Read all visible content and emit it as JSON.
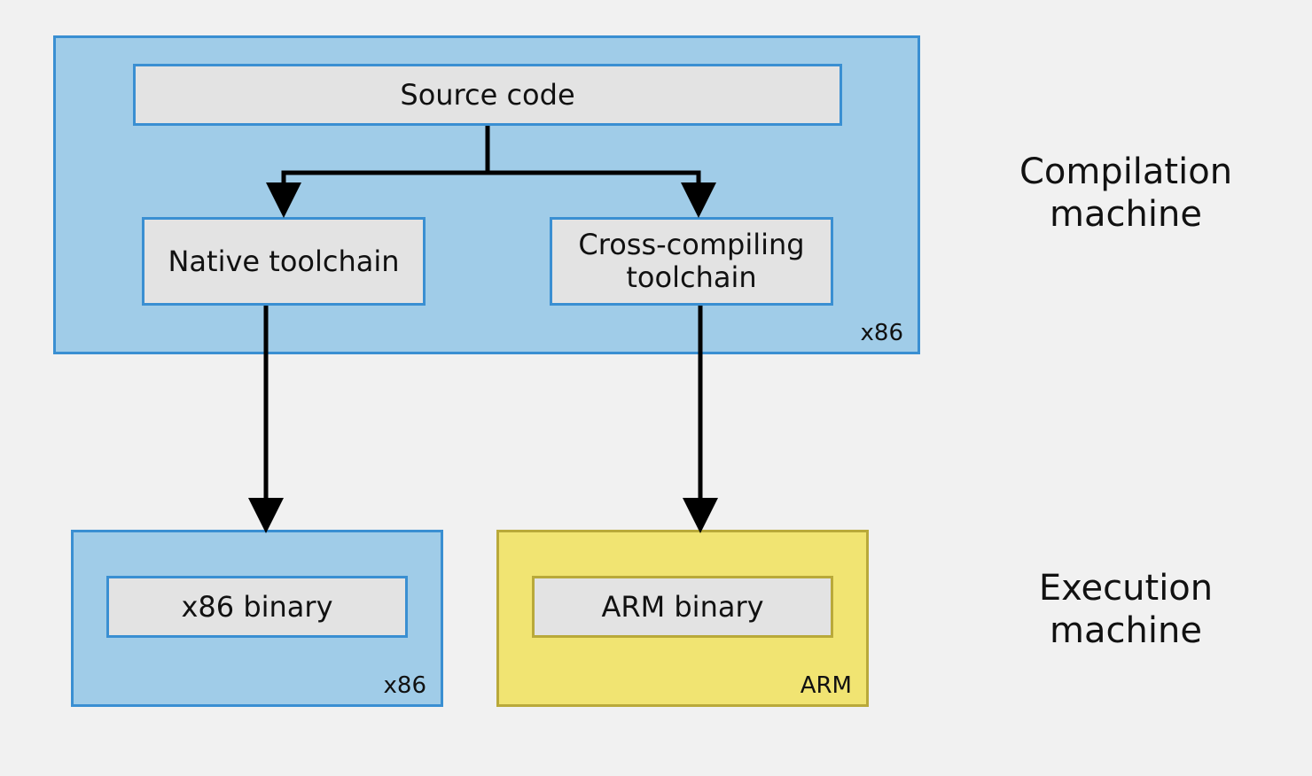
{
  "containers": {
    "compilation": {
      "arch": "x86"
    },
    "exec_x86": {
      "arch": "x86"
    },
    "exec_arm": {
      "arch": "ARM"
    }
  },
  "boxes": {
    "source": {
      "label": "Source code"
    },
    "native": {
      "label": "Native toolchain"
    },
    "cross": {
      "label": "Cross-compiling\ntoolchain"
    },
    "x86bin": {
      "label": "x86 binary"
    },
    "armbin": {
      "label": "ARM binary"
    }
  },
  "side": {
    "compilation": "Compilation\nmachine",
    "execution": "Execution\nmachine"
  },
  "edges": [
    {
      "from": "source",
      "to": "native"
    },
    {
      "from": "source",
      "to": "cross"
    },
    {
      "from": "native",
      "to": "x86bin"
    },
    {
      "from": "cross",
      "to": "armbin"
    }
  ]
}
